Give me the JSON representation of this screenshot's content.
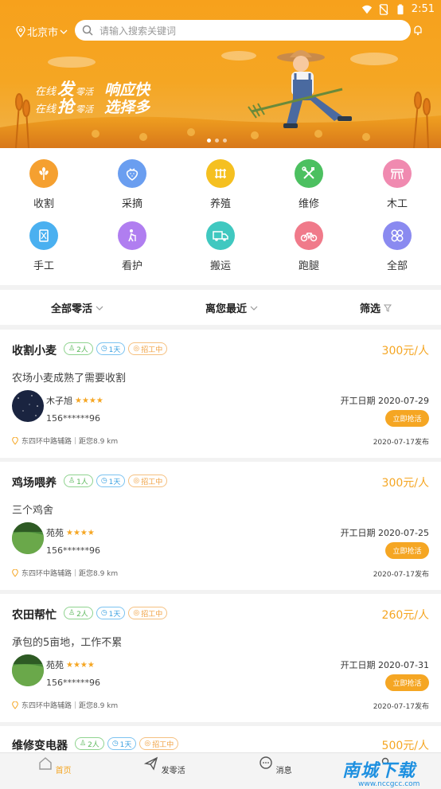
{
  "status_bar": {
    "time": "2:51"
  },
  "header": {
    "city": "北京市",
    "search_placeholder": "请输入搜索关键词"
  },
  "banner": {
    "line1": {
      "a": "在线",
      "b": "发",
      "c": "零活",
      "d": "响应快"
    },
    "line2": {
      "a": "在线",
      "b": "抢",
      "c": "零活",
      "d": "选择多"
    }
  },
  "categories": [
    {
      "label": "收割",
      "color": "#f5a030",
      "icon": "wheat-icon"
    },
    {
      "label": "采摘",
      "color": "#6a9ef0",
      "icon": "strawberry-icon"
    },
    {
      "label": "养殖",
      "color": "#f5c020",
      "icon": "fence-icon"
    },
    {
      "label": "维修",
      "color": "#4cc060",
      "icon": "tools-icon"
    },
    {
      "label": "木工",
      "color": "#f08ab0",
      "icon": "sawhorse-icon"
    },
    {
      "label": "手工",
      "color": "#4ab0f0",
      "icon": "handcraft-icon"
    },
    {
      "label": "看护",
      "color": "#b07ef0",
      "icon": "elderly-care-icon"
    },
    {
      "label": "搬运",
      "color": "#40c8c0",
      "icon": "truck-icon"
    },
    {
      "label": "跑腿",
      "color": "#f07a8a",
      "icon": "bicycle-icon"
    },
    {
      "label": "全部",
      "color": "#8a8af0",
      "icon": "all-grid-icon"
    }
  ],
  "filters": {
    "all_jobs": "全部零活",
    "nearest": "离您最近",
    "filter": "筛选"
  },
  "jobs": [
    {
      "title": "收割小麦",
      "people": "2人",
      "days": "1天",
      "status": "招工中",
      "price": "300元/人",
      "desc": "农场小麦成熟了需要收割",
      "user": "木子旭",
      "stars": "★★★★",
      "phone": "156******96",
      "start": "开工日期 2020-07-29",
      "grab": "立即抢活",
      "location": "东四环中路辅路｜距您8.9 km",
      "published": "2020-07-17发布",
      "avatar": "night"
    },
    {
      "title": "鸡场喂养",
      "people": "1人",
      "days": "1天",
      "status": "招工中",
      "price": "300元/人",
      "desc": "三个鸡舍",
      "user": "苑苑",
      "stars": "★★★★",
      "phone": "156******96",
      "start": "开工日期 2020-07-25",
      "grab": "立即抢活",
      "location": "东四环中路辅路｜距您8.9 km",
      "published": "2020-07-17发布",
      "avatar": "field"
    },
    {
      "title": "农田帮忙",
      "people": "2人",
      "days": "1天",
      "status": "招工中",
      "price": "260元/人",
      "desc": "承包的5亩地，工作不累",
      "user": "苑苑",
      "stars": "★★★★",
      "phone": "156******96",
      "start": "开工日期 2020-07-31",
      "grab": "立即抢活",
      "location": "东四环中路辅路｜距您8.9 km",
      "published": "2020-07-17发布",
      "avatar": "field"
    },
    {
      "title": "维修变电器",
      "people": "2人",
      "days": "1天",
      "status": "招工中",
      "price": "500元/人"
    }
  ],
  "bottom_nav": [
    {
      "label": "首页",
      "active": true
    },
    {
      "label": "发零活",
      "active": false
    },
    {
      "label": "消息",
      "active": false
    },
    {
      "label": "",
      "active": false
    }
  ],
  "watermark": {
    "title": "南城下载",
    "sub": "www.nccgcc.com"
  },
  "colors": {
    "accent": "#f5a623",
    "green": "#5cb85c",
    "blue": "#3aa0e0"
  }
}
